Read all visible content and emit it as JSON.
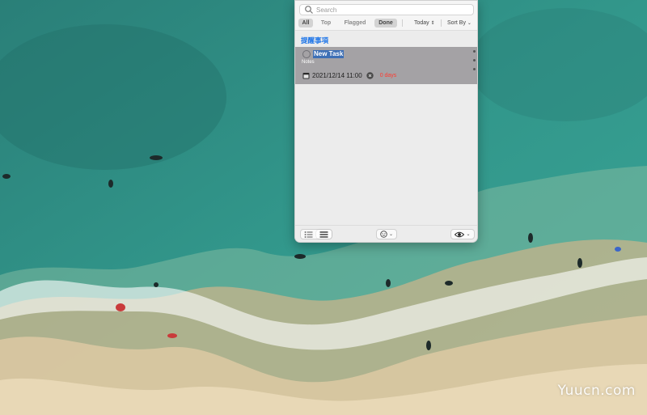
{
  "popover": {
    "search": {
      "placeholder": "Search",
      "value": ""
    },
    "filters": [
      {
        "label": "All",
        "active": true
      },
      {
        "label": "Top",
        "active": false
      },
      {
        "label": "Flagged",
        "active": false
      },
      {
        "label": "Done",
        "active": true
      }
    ],
    "date_filter": {
      "label": "Today",
      "icon": "updown-chevron-icon"
    },
    "sort": {
      "label": "Sort By",
      "icon": "chevron-down-icon"
    },
    "list_title": "提醒事項",
    "tasks": [
      {
        "title": "New Task",
        "notes": "Notes",
        "due": "2021/12/14  11:00",
        "overdue": "0 days"
      }
    ],
    "bottom": {
      "view_modes": [
        "list-icon",
        "lines-icon"
      ],
      "smile_icon": "smile-icon",
      "eye_icon": "eye-icon"
    }
  },
  "watermark": "Yuucn.com",
  "colors": {
    "accent": "#1a73e8",
    "overdue": "#ff3b30",
    "row_bg": "#a4a2a5",
    "selection": "#3d6fb5",
    "sea": "#2f8f85"
  }
}
